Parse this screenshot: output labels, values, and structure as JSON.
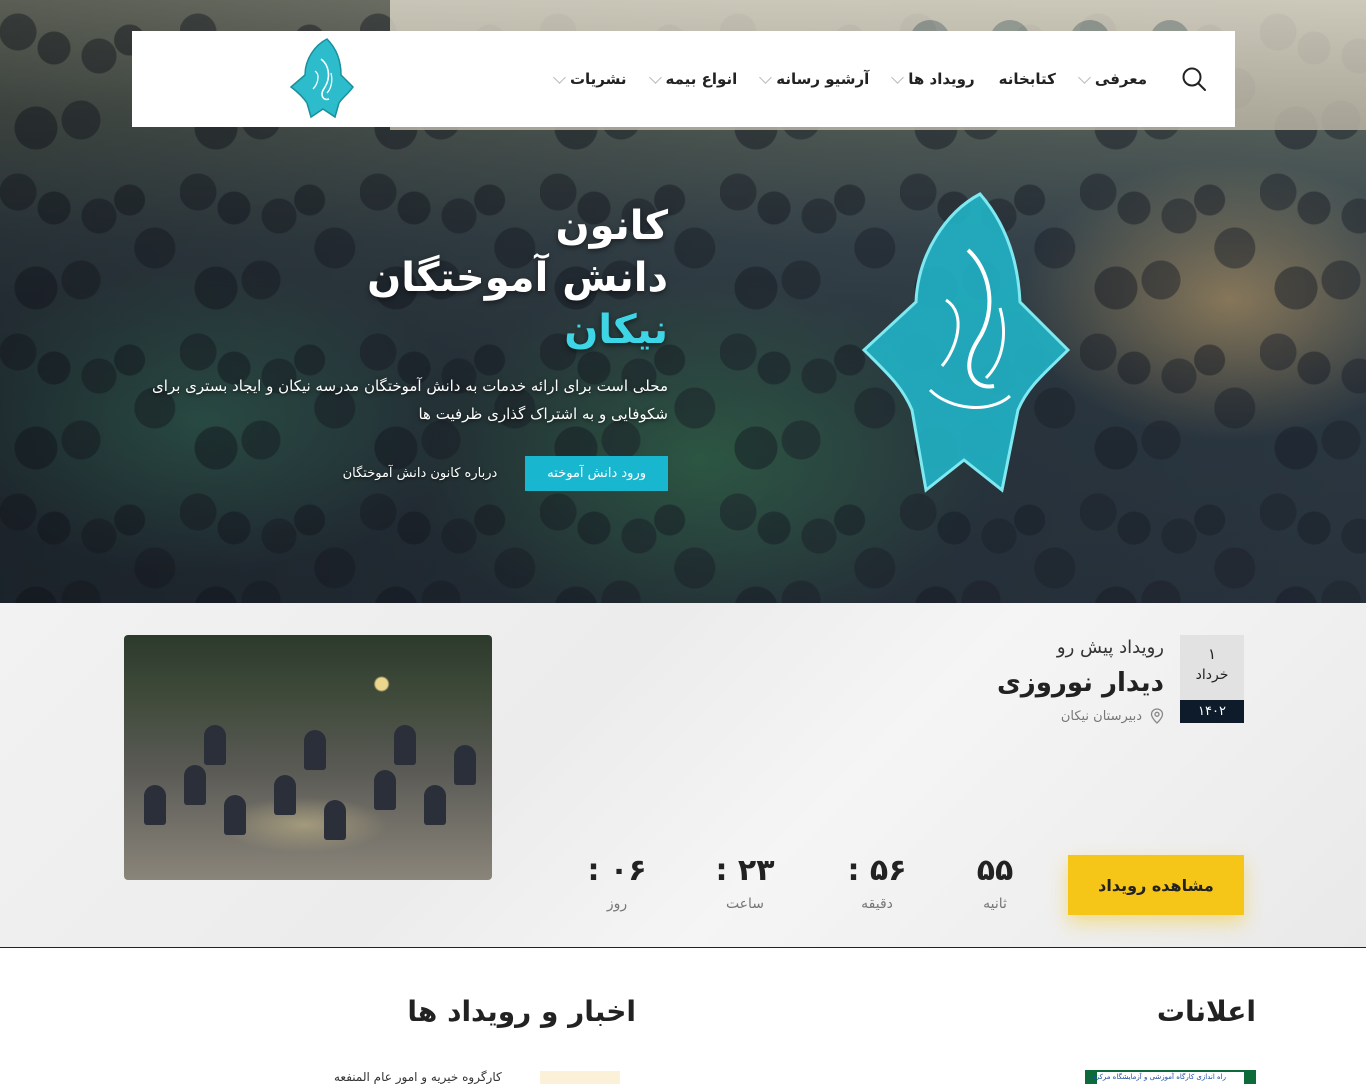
{
  "nav": {
    "items": [
      {
        "label": "معرفی",
        "dropdown": true
      },
      {
        "label": "کتابخانه",
        "dropdown": false
      },
      {
        "label": "رویداد ها",
        "dropdown": true
      },
      {
        "label": "آرشیو رسانه",
        "dropdown": true
      },
      {
        "label": "انواع بیمه",
        "dropdown": true
      },
      {
        "label": "نشریات",
        "dropdown": true
      }
    ],
    "search_icon": "search-icon",
    "logo": "kanoon-emblem-logo"
  },
  "hero": {
    "title_line1": "کانون",
    "title_line2": "دانش آموختگان",
    "title_accent": "نیکان",
    "description": "محلی است برای ارائه خدمات به دانش آموختگان مدرسه نیکان و ایجاد بستری برای شکوفایی و به اشتراک گذاری ظرفیت ها",
    "primary_button": "ورود دانش آموخته",
    "secondary_link": "درباره کانون دانش آموختگان"
  },
  "event": {
    "date_day": "۱",
    "date_month": "خرداد",
    "date_year": "۱۴۰۲",
    "kicker": "رویداد پیش رو",
    "title": "دیدار نوروزی",
    "location": "دبیرستان نیکان",
    "countdown": {
      "seconds": {
        "value": "۵۵",
        "label": "ثانیه"
      },
      "minutes": {
        "value": "۵۶ :",
        "label": "دقیقه"
      },
      "hours": {
        "value": "۲۳ :",
        "label": "ساعت"
      },
      "days": {
        "value": "۰۶ :",
        "label": "روز"
      }
    },
    "view_button": "مشاهده رویداد"
  },
  "sections": {
    "notices_title": "اعلانات",
    "news_title": "اخبار و رویداد ها",
    "news_first_item": "کارگروه خیریه و امور عام المنفعه",
    "notice_first_caption": "راه اندازی کارگاه آموزشی و آزمایشگاه مرکزی"
  },
  "colors": {
    "accent_teal": "#18b7cf",
    "accent_title": "#3ed6e6",
    "cta_yellow": "#f5c518",
    "date_year_bg": "#0d1b2a"
  }
}
